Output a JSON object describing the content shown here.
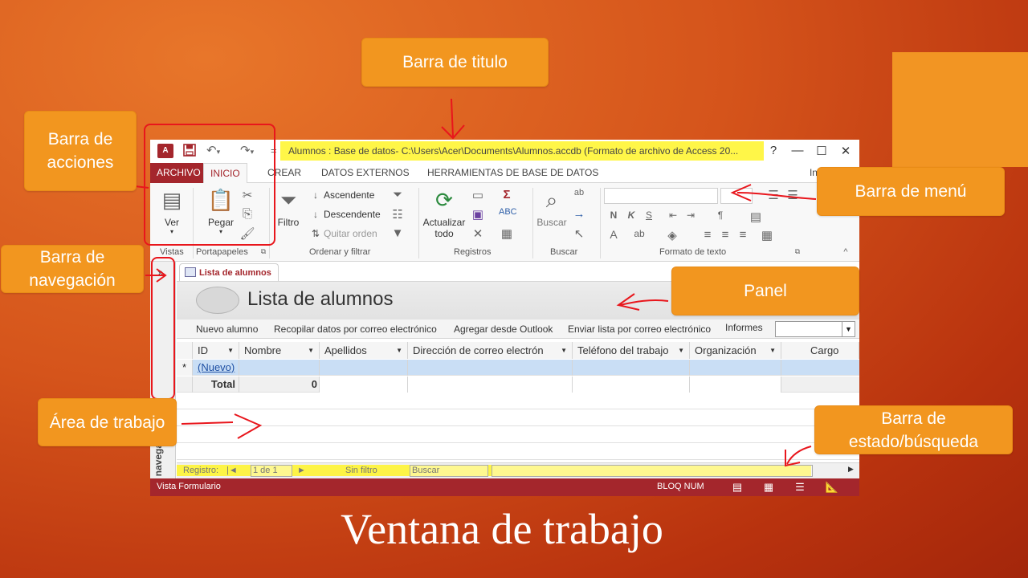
{
  "slide": {
    "caption": "Ventana de trabajo"
  },
  "callouts": {
    "titulo": "Barra de titulo",
    "acciones": "Barra de acciones",
    "menu": "Barra de menú",
    "navegacion": "Barra de navegación",
    "panel": "Panel",
    "trabajo": "Área de trabajo",
    "estado": "Barra de estado/búsqueda"
  },
  "window": {
    "title": "Alumnos : Base de datos- C:\\Users\\Acer\\Documents\\Alumnos.accdb (Formato de archivo de Access 20...",
    "help": "?",
    "minimize": "—",
    "maximize": "☐",
    "close": "✕",
    "app_icon": "A"
  },
  "qat": {
    "save_icon": "floppy-disk",
    "undo_icon": "undo-arrow",
    "redo_icon": "redo-arrow"
  },
  "tabs": {
    "archivo": "ARCHIVO",
    "inicio": "INICIO",
    "crear": "CREAR",
    "datos_externos": "DATOS EXTERNOS",
    "herramientas": "HERRAMIENTAS DE BASE DE DATOS",
    "sign_in": "Iniciar ses"
  },
  "ribbon": {
    "vistas": {
      "ver": "Ver",
      "label": "Vistas"
    },
    "portapapeles": {
      "pegar": "Pegar",
      "label": "Portapapeles"
    },
    "ordenar": {
      "filtro": "Filtro",
      "ascendente": "Ascendente",
      "descendente": "Descendente",
      "quitar_orden": "Quitar orden",
      "label": "Ordenar y filtrar"
    },
    "registros": {
      "actualizar": "Actualizar",
      "todo": "todo",
      "label": "Registros"
    },
    "buscar": {
      "buscar": "Buscar",
      "label": "Buscar"
    },
    "formato": {
      "bold": "N",
      "italic": "K",
      "underline": "S",
      "font_color": "A",
      "label": "Formato de texto"
    }
  },
  "nav_pane": {
    "chevron": "»",
    "label": "Panel de navegación"
  },
  "document": {
    "tab_label": "Lista de alumnos",
    "form_title": "Lista de alumnos",
    "actions": [
      "Nuevo alumno",
      "Recopilar datos por correo electrónico",
      "Agregar desde Outlook",
      "Enviar lista por correo electrónico",
      "Informes"
    ]
  },
  "grid": {
    "columns": [
      "ID",
      "Nombre",
      "Apellidos",
      "Dirección de correo electrón",
      "Teléfono del trabajo",
      "Organización",
      "Cargo"
    ],
    "new_row": {
      "marker": "*",
      "id": "(Nuevo)"
    },
    "total_row": {
      "label": "Total",
      "value": "0"
    }
  },
  "record_nav": {
    "registro": "Registro:",
    "first": "|◄",
    "box": "1 de 1",
    "next": "►",
    "filter": "Sin filtro",
    "search": "Buscar"
  },
  "statusbar": {
    "left": "Vista Formulario",
    "right": "BLOQ NUM"
  },
  "colors": {
    "access_red": "#a4262c",
    "callout_orange": "#f2961f",
    "highlight_yellow": "#fff528",
    "annotation_red": "#e8161c"
  }
}
